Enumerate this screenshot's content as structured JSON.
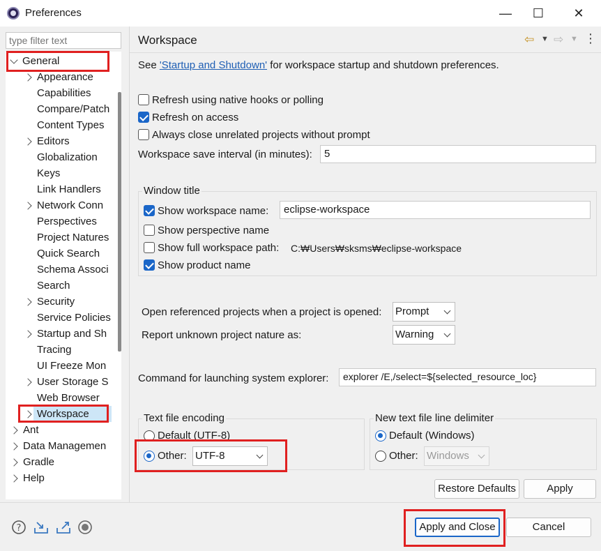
{
  "window": {
    "title": "Preferences",
    "minimize": "—",
    "maximize": "☐",
    "close": "✕"
  },
  "filter": {
    "placeholder": "type filter text"
  },
  "tree": {
    "general": "General",
    "children": [
      "Appearance",
      "Capabilities",
      "Compare/Patch",
      "Content Types",
      "Editors",
      "Globalization",
      "Keys",
      "Link Handlers",
      "Network Conn",
      "Perspectives",
      "Project Natures",
      "Quick Search",
      "Schema Associ",
      "Search",
      "Security",
      "Service Policies",
      "Startup and Sh",
      "Tracing",
      "UI Freeze Mon",
      "User Storage S",
      "Web Browser",
      "Workspace"
    ],
    "roots": [
      "Ant",
      "Data Managemen",
      "Gradle",
      "Help"
    ]
  },
  "page": {
    "title": "Workspace",
    "see_prefix": "See ",
    "see_link": "'Startup and Shutdown'",
    "see_suffix": " for workspace startup and shutdown preferences.",
    "refresh_native": "Refresh using native hooks or polling",
    "refresh_access": "Refresh on access",
    "always_close": "Always close unrelated projects without prompt",
    "save_interval_label": "Workspace save interval (in minutes):",
    "save_interval_value": "5",
    "window_title_group": "Window title",
    "show_ws_name": "Show workspace name:",
    "ws_name_value": "eclipse-workspace",
    "show_perspective": "Show perspective name",
    "show_full_path": "Show full workspace path:",
    "full_path_value": "C:₩Users₩sksms₩eclipse-workspace",
    "show_product": "Show product name",
    "open_ref_label": "Open referenced projects when a project is opened:",
    "open_ref_value": "Prompt",
    "report_unknown_label": "Report unknown project nature as:",
    "report_unknown_value": "Warning",
    "cmd_label": "Command for launching system explorer:",
    "cmd_value": "explorer /E,/select=${selected_resource_loc}",
    "encoding_group": "Text file encoding",
    "enc_default": "Default (UTF-8)",
    "enc_other": "Other:",
    "enc_other_value": "UTF-8",
    "delim_group": "New text file line delimiter",
    "delim_default": "Default (Windows)",
    "delim_other": "Other:",
    "delim_other_value": "Windows",
    "restore_defaults": "Restore Defaults",
    "apply": "Apply"
  },
  "footer": {
    "apply_close": "Apply and Close",
    "cancel": "Cancel"
  },
  "colors": {
    "accent": "#1a66c8",
    "highlight": "#e02020",
    "link": "#1f5fb4"
  }
}
